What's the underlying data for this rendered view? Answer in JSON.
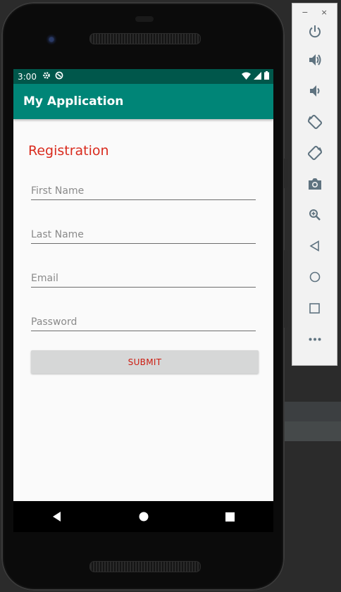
{
  "status_bar": {
    "time": "3:00"
  },
  "app_bar": {
    "title": "My Application"
  },
  "form": {
    "heading": "Registration",
    "fields": [
      {
        "name": "first-name",
        "placeholder": "First Name",
        "value": ""
      },
      {
        "name": "last-name",
        "placeholder": "Last Name",
        "value": ""
      },
      {
        "name": "email",
        "placeholder": "Email",
        "value": ""
      },
      {
        "name": "password",
        "placeholder": "Password",
        "value": ""
      }
    ],
    "submit_label": "SUBMIT"
  },
  "emulator_toolbar": {
    "minimize_label": "−",
    "close_label": "×",
    "buttons": [
      "power-icon",
      "volume-up-icon",
      "volume-down-icon",
      "rotate-left-icon",
      "rotate-right-icon",
      "camera-icon",
      "zoom-icon",
      "back-icon",
      "home-icon",
      "overview-icon",
      "more-icon"
    ]
  },
  "colors": {
    "status_bar": "#00574b",
    "app_bar": "#008577",
    "accent_red": "#d92b1e",
    "button_bg": "#d6d7d7"
  }
}
